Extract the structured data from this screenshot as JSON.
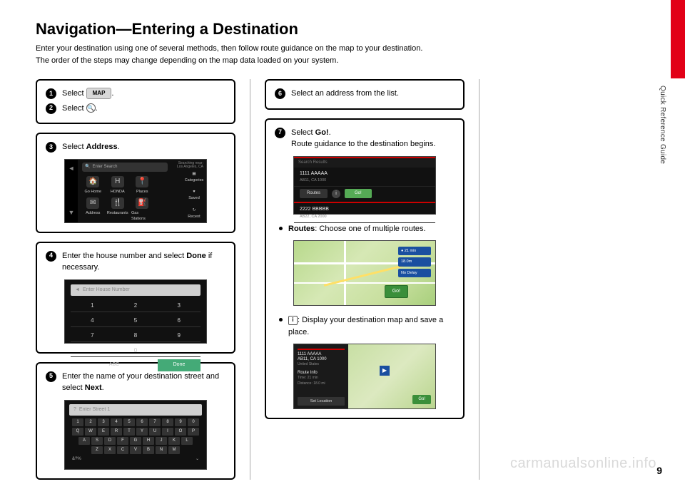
{
  "page": {
    "title": "Navigation—Entering a Destination",
    "intro_line1": "Enter your destination using one of several methods, then follow route guidance on the map to your destination.",
    "intro_line2": "The order of the steps may change depending on the map data loaded on your system.",
    "side_label": "Quick Reference Guide",
    "page_number": "9",
    "watermark": "carmanualsonline.info"
  },
  "steps": {
    "s1": {
      "num": "1",
      "pre": "Select ",
      "btn": "MAP",
      "post": "."
    },
    "s2": {
      "num": "2",
      "pre": "Select ",
      "post": "."
    },
    "s3": {
      "num": "3",
      "pre": "Select ",
      "bold": "Address",
      "post": "."
    },
    "s4": {
      "num": "4",
      "line1_pre": "Enter the house number and select ",
      "line1_bold": "Done",
      "line1_post": " if necessary."
    },
    "s5": {
      "num": "5",
      "line_pre": "Enter the name of your destination street and select ",
      "line_bold": "Next",
      "line_post": "."
    },
    "s6": {
      "num": "6",
      "text": "Select an address from the list."
    },
    "s7": {
      "num": "7",
      "line1_pre": "Select ",
      "line1_bold": "Go!",
      "line1_post": ".",
      "line2": "Route guidance to the destination begins.",
      "bullet1_bold": "Routes",
      "bullet1_post": ": Choose one of multiple routes.",
      "bullet2_post": ": Display your destination map and save a place."
    }
  },
  "shots": {
    "s3": {
      "search_placeholder": "Enter Search",
      "top_right_1": "Searching near:",
      "top_right_2": "Los Angeles, CA",
      "tiles": [
        "Go Home",
        "HONDA",
        "Places",
        "Address",
        "Restaurants",
        "Gas Stations"
      ],
      "right_items": [
        "Categories",
        "Saved",
        "Recent"
      ]
    },
    "s4": {
      "placeholder": "Enter House Number",
      "keys": [
        "1",
        "2",
        "3",
        "4",
        "5",
        "6",
        "7",
        "8",
        "9",
        "",
        "0",
        ""
      ],
      "abc": "ABC",
      "done": "Done"
    },
    "s5": {
      "placeholder": "Enter Street 1",
      "row1": [
        "1",
        "2",
        "3",
        "4",
        "5",
        "6",
        "7",
        "8",
        "9",
        "0"
      ],
      "row2": [
        "Q",
        "W",
        "E",
        "R",
        "T",
        "Y",
        "U",
        "I",
        "O",
        "P"
      ],
      "row3": [
        "A",
        "S",
        "D",
        "F",
        "G",
        "H",
        "J",
        "K",
        "L"
      ],
      "row4": [
        "Z",
        "X",
        "C",
        "V",
        "B",
        "N",
        "M"
      ],
      "foot_left": "&?%",
      "foot_right": "⌄"
    },
    "s7": {
      "header": "Search Results",
      "item1_t": "1111 AAAAA",
      "item1_s": "AB11, CA 1000",
      "routes": "Routes",
      "go": "Go!",
      "item2_t": "2222 BBBBB",
      "item2_s": "AB22, CA 2000"
    },
    "map1": {
      "chip1": "● 21 min",
      "chip2": "18.0m",
      "chip3": "No Delay",
      "go": "Go!"
    },
    "map2": {
      "addr1": "1111 AAAAA",
      "addr2": "AB11, CA 1000",
      "addr3": "United States",
      "route_hdr": "Route Info",
      "route_1": "Time: 21 min",
      "route_2": "Distance: 18.0 mi",
      "set_loc": "Set Location",
      "go": "Go!"
    }
  }
}
